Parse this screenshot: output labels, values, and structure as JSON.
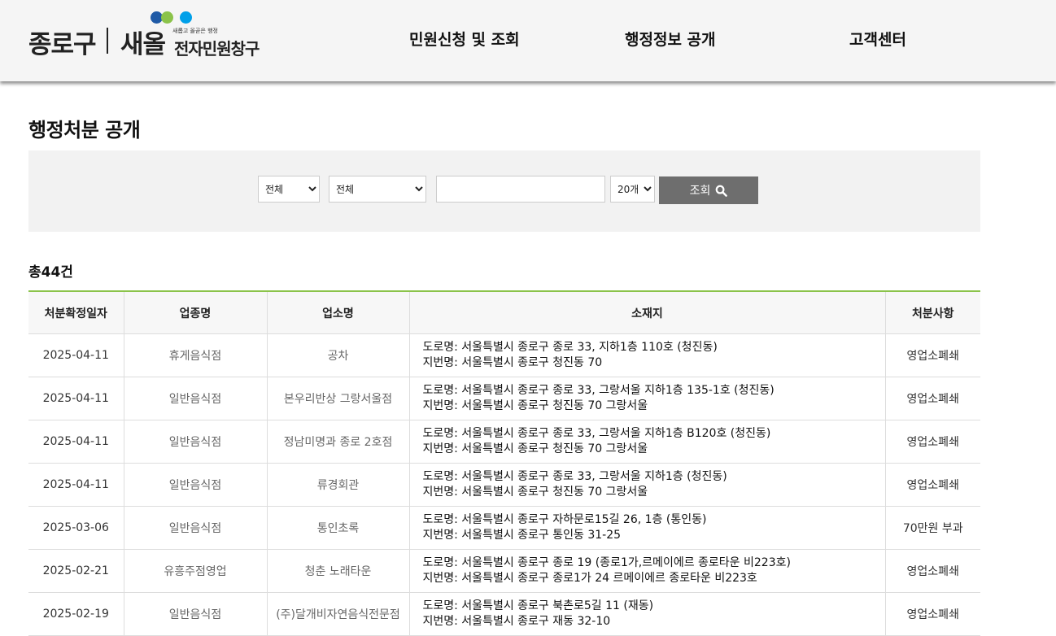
{
  "header": {
    "logo_jongno": "종로구",
    "logo_saeol": "새올",
    "logo_tagline": "새롭고 올곧은 행정",
    "logo_sub": "전자민원창구",
    "dot_colors": [
      "#1f5aa6",
      "#8bc34a",
      "#00a0e9"
    ],
    "nav": [
      {
        "label": "민원신청 및 조회"
      },
      {
        "label": "행정정보 공개"
      },
      {
        "label": "고객센터"
      }
    ]
  },
  "page_title": "행정처분 공개",
  "search": {
    "category_value": "전체",
    "type_value": "전체",
    "keyword_value": "",
    "page_size_value": "20개",
    "button_label": "조회",
    "button_icon": "search-icon"
  },
  "total": "총44건",
  "table": {
    "headers": [
      "처분확정일자",
      "업종명",
      "업소명",
      "소재지",
      "처분사항"
    ],
    "rows": [
      {
        "date": "2025-04-11",
        "industry": "휴게음식점",
        "name": "공차",
        "road": "도로명: 서울특별시 종로구 종로 33, 지하1층 110호 (청진동)",
        "lot": "지번명: 서울특별시 종로구 청진동 70",
        "action": "영업소폐쇄"
      },
      {
        "date": "2025-04-11",
        "industry": "일반음식점",
        "name": "본우리반상 그랑서울점",
        "road": "도로명: 서울특별시 종로구 종로 33, 그랑서울 지하1층 135-1호 (청진동)",
        "lot": "지번명: 서울특별시 종로구 청진동 70 그랑서울",
        "action": "영업소폐쇄"
      },
      {
        "date": "2025-04-11",
        "industry": "일반음식점",
        "name": "정남미명과 종로 2호점",
        "road": "도로명: 서울특별시 종로구 종로 33, 그랑서울 지하1층 B120호 (청진동)",
        "lot": "지번명: 서울특별시 종로구 청진동 70 그랑서울",
        "action": "영업소폐쇄"
      },
      {
        "date": "2025-04-11",
        "industry": "일반음식점",
        "name": "류경회관",
        "road": "도로명: 서울특별시 종로구 종로 33, 그랑서울 지하1층 (청진동)",
        "lot": "지번명: 서울특별시 종로구 청진동 70 그랑서울",
        "action": "영업소폐쇄"
      },
      {
        "date": "2025-03-06",
        "industry": "일반음식점",
        "name": "통인초록",
        "road": "도로명: 서울특별시 종로구 자하문로15길 26, 1층 (통인동)",
        "lot": "지번명: 서울특별시 종로구 통인동 31-25",
        "action": "70만원 부과"
      },
      {
        "date": "2025-02-21",
        "industry": "유흥주점영업",
        "name": "청춘 노래타운",
        "road": "도로명: 서울특별시 종로구 종로 19 (종로1가,르메이에르 종로타운 비223호)",
        "lot": "지번명: 서울특별시 종로구 종로1가 24 르메이에르 종로타운 비223호",
        "action": "영업소폐쇄"
      },
      {
        "date": "2025-02-19",
        "industry": "일반음식점",
        "name": "(주)달개비자연음식전문점",
        "road": "도로명: 서울특별시 종로구 북촌로5길 11 (재동)",
        "lot": "지번명: 서울특별시 종로구 재동 32-10",
        "action": "영업소폐쇄"
      }
    ]
  }
}
